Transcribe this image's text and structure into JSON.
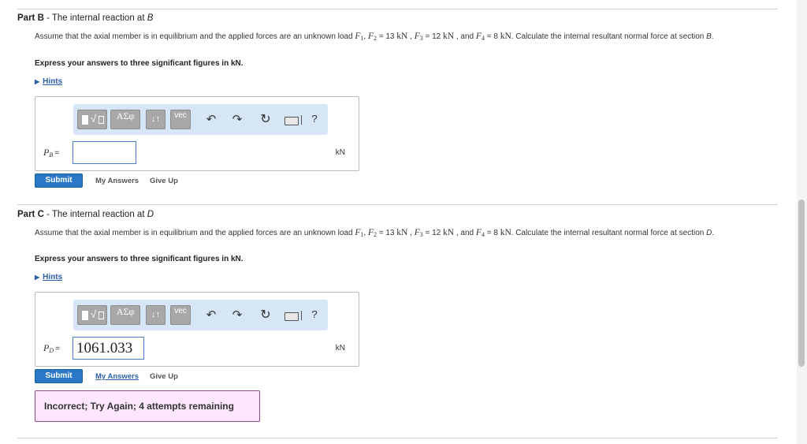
{
  "partB": {
    "label": "Part B",
    "dash": " - ",
    "title_text": "The internal reaction at ",
    "title_var": "B",
    "desc_1": "Assume that the axial member is in equilibrium and the applied forces are an unknown load ",
    "f1": "F",
    "f1_sub": "1",
    "f2": "F",
    "f2_sub": "2",
    "f2_val": " = 13 ",
    "f2_unit": "kN",
    "f3": "F",
    "f3_sub": "3",
    "f3_val": " = 12 ",
    "f3_unit": "kN",
    "and": " , and ",
    "f4": "F",
    "f4_sub": "4",
    "f4_val": " = 8 ",
    "f4_unit": "kN",
    "desc_2": ". Calculate the internal resultant normal force at section ",
    "section": "B",
    "period": ".",
    "express": "Express your answers to three significant figures in kN.",
    "hints": "Hints",
    "var_main": "P",
    "var_sub": "B",
    "equals": "=",
    "input_value": "",
    "unit": "kN",
    "submit": "Submit",
    "my_answers": "My Answers",
    "give_up": "Give Up"
  },
  "partC": {
    "label": "Part C",
    "dash": " - ",
    "title_text": "The internal reaction at ",
    "title_var": "D",
    "desc_1": "Assume that the axial member is in equilibrium and the applied forces are an unknown load ",
    "f1": "F",
    "f1_sub": "1",
    "f2": "F",
    "f2_sub": "2",
    "f2_val": " = 13 ",
    "f2_unit": "kN",
    "f3": "F",
    "f3_sub": "3",
    "f3_val": " = 12 ",
    "f3_unit": "kN",
    "and": " , and ",
    "f4": "F",
    "f4_sub": "4",
    "f4_val": " = 8 ",
    "f4_unit": "kN",
    "desc_2": ". Calculate the internal resultant normal force at section ",
    "section": "D",
    "period": ".",
    "express": "Express your answers to three significant figures in kN.",
    "hints": "Hints",
    "var_main": "P",
    "var_sub": "D",
    "equals": "=",
    "input_value": "1061.033",
    "unit": "kN",
    "submit": "Submit",
    "my_answers": "My Answers",
    "give_up": "Give Up",
    "feedback": "Incorrect; Try Again; 4 attempts remaining"
  },
  "toolbar": {
    "greek": "ΑΣφ",
    "arrows": "↓↑",
    "vec": "vec",
    "radical": "√",
    "undo": "↶",
    "redo": "↷",
    "reset": "↻",
    "help": "?"
  },
  "icons": {
    "templates": "templates-icon",
    "undo": "undo-icon",
    "redo": "redo-icon",
    "reset": "reset-icon",
    "keyboard": "keyboard-icon",
    "help": "help-icon",
    "hint_toggle": "triangle-right-icon"
  },
  "colors": {
    "link": "#2a5ea8",
    "submit": "#2a78c6",
    "toolbar_bg": "#d6e6f7",
    "input_border": "#4a7cc9",
    "feedback_bg": "#fbe6fb",
    "feedback_border": "#8e4a8e"
  }
}
